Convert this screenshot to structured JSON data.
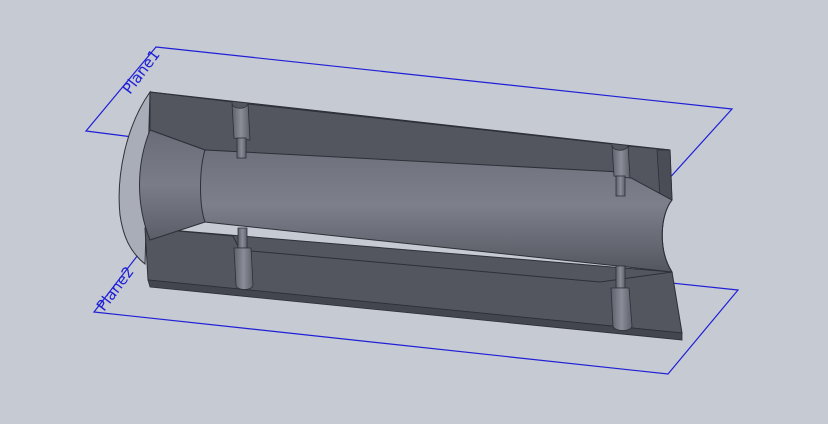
{
  "viewport": {
    "background_color": "#c6cad3",
    "part_color": "#53555f",
    "plane_color": "#1f1fd6"
  },
  "planes": [
    {
      "name": "Plane1"
    },
    {
      "name": "Plane2"
    }
  ]
}
